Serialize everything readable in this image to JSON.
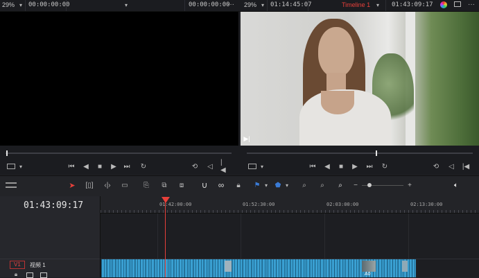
{
  "source_viewer": {
    "zoom": "29%",
    "timecode_left": "00:00:00:00",
    "timecode_right": "00:00:00:00"
  },
  "timeline_viewer": {
    "zoom": "29%",
    "duration": "01:14:45:07",
    "timeline_name": "Timeline 1",
    "timecode": "01:43:09:17"
  },
  "timeline": {
    "current_timecode": "01:43:09:17",
    "ruler_labels": [
      "01:42:00:00",
      "01:52:30:00",
      "02:03:00:00",
      "02:13:30:00"
    ],
    "track_label": "V1",
    "track_name": "视频 1",
    "clip_badge": "A0"
  },
  "colors": {
    "accent_red": "#e8403a",
    "clip_blue": "#3aa0d2",
    "panel_bg": "#1f2024",
    "bar_bg": "#1b1c20"
  },
  "icons": [
    "chevron-down-icon",
    "more-icon",
    "play-icon",
    "stop-icon",
    "loop-icon",
    "snap-icon",
    "link-icon",
    "lock-icon",
    "flag-icon",
    "marker-icon",
    "zoom-icon",
    "volume-icon",
    "pointer-icon"
  ]
}
